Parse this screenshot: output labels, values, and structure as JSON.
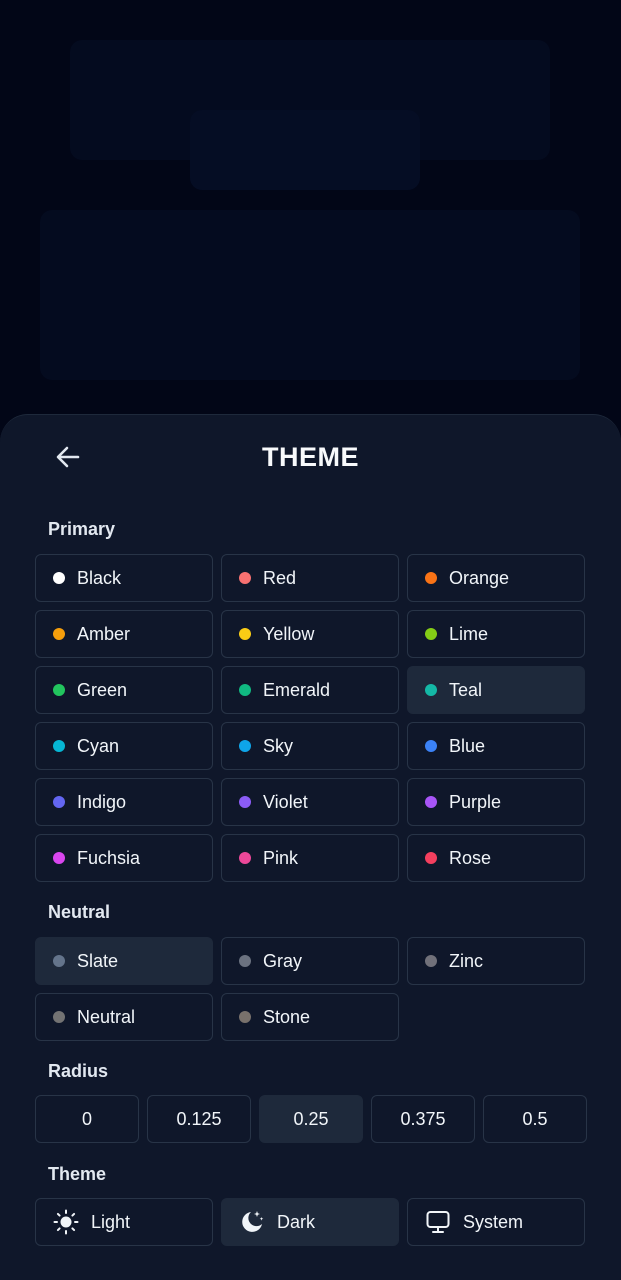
{
  "header": {
    "title": "THEME",
    "back_icon": "arrow-left-icon"
  },
  "primary": {
    "label": "Primary",
    "selected": "Teal",
    "options": [
      {
        "label": "Black",
        "color": "#ffffff"
      },
      {
        "label": "Red",
        "color": "#f87171"
      },
      {
        "label": "Orange",
        "color": "#f97316"
      },
      {
        "label": "Amber",
        "color": "#f59e0b"
      },
      {
        "label": "Yellow",
        "color": "#facc15"
      },
      {
        "label": "Lime",
        "color": "#84cc16"
      },
      {
        "label": "Green",
        "color": "#22c55e"
      },
      {
        "label": "Emerald",
        "color": "#10b981"
      },
      {
        "label": "Teal",
        "color": "#14b8a6"
      },
      {
        "label": "Cyan",
        "color": "#06b6d4"
      },
      {
        "label": "Sky",
        "color": "#0ea5e9"
      },
      {
        "label": "Blue",
        "color": "#3b82f6"
      },
      {
        "label": "Indigo",
        "color": "#6366f1"
      },
      {
        "label": "Violet",
        "color": "#8b5cf6"
      },
      {
        "label": "Purple",
        "color": "#a855f7"
      },
      {
        "label": "Fuchsia",
        "color": "#d946ef"
      },
      {
        "label": "Pink",
        "color": "#ec4899"
      },
      {
        "label": "Rose",
        "color": "#f43f5e"
      }
    ]
  },
  "neutral": {
    "label": "Neutral",
    "selected": "Slate",
    "options": [
      {
        "label": "Slate",
        "color": "#64748b"
      },
      {
        "label": "Gray",
        "color": "#6b7280"
      },
      {
        "label": "Zinc",
        "color": "#71717a"
      },
      {
        "label": "Neutral",
        "color": "#737373"
      },
      {
        "label": "Stone",
        "color": "#78716c"
      }
    ]
  },
  "radius": {
    "label": "Radius",
    "selected": "0.25",
    "options": [
      "0",
      "0.125",
      "0.25",
      "0.375",
      "0.5"
    ]
  },
  "theme": {
    "label": "Theme",
    "selected": "Dark",
    "options": [
      {
        "label": "Light",
        "icon": "sun-icon"
      },
      {
        "label": "Dark",
        "icon": "moon-stars-icon"
      },
      {
        "label": "System",
        "icon": "monitor-icon"
      }
    ]
  },
  "colors": {
    "sheet_bg": "#0f172a",
    "selected_bg": "#1e293b",
    "border": "#283447"
  }
}
